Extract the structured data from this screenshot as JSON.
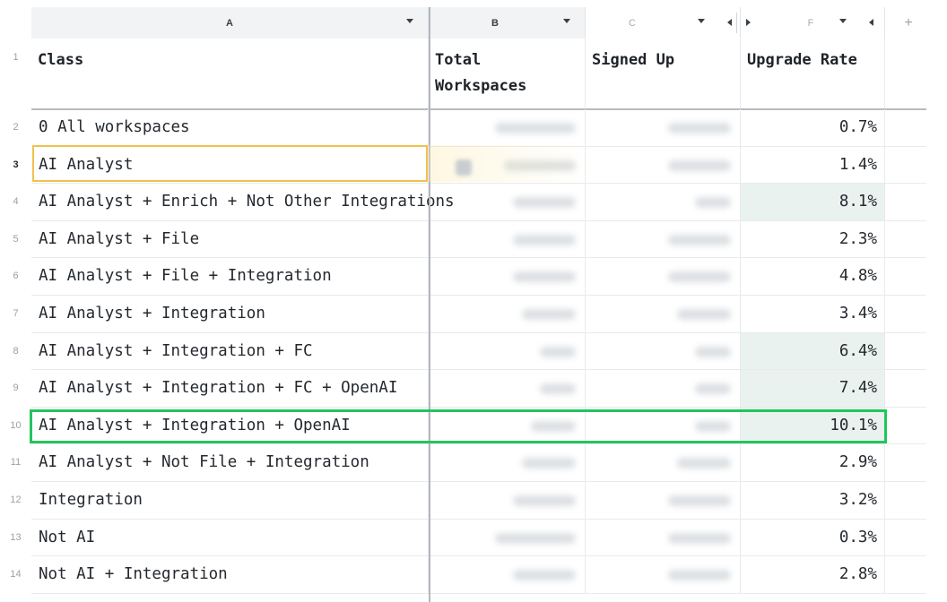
{
  "columns": {
    "a": "A",
    "b": "B",
    "c": "C",
    "f": "F",
    "add": "+"
  },
  "header": {
    "row_number": "1",
    "class": "Class",
    "total_workspaces_line1": "Total",
    "total_workspaces_line2": "Workspaces",
    "signed_up": "Signed Up",
    "upgrade_rate": "Upgrade Rate"
  },
  "rows": [
    {
      "n": "2",
      "class": "0 All workspaces",
      "rate": "0.7%"
    },
    {
      "n": "3",
      "class": "AI Analyst",
      "rate": "1.4%"
    },
    {
      "n": "4",
      "class": "AI Analyst + Enrich + Not Other Integrations",
      "rate": "8.1%"
    },
    {
      "n": "5",
      "class": "AI Analyst + File",
      "rate": "2.3%"
    },
    {
      "n": "6",
      "class": "AI Analyst + File + Integration",
      "rate": "4.8%"
    },
    {
      "n": "7",
      "class": "AI Analyst + Integration",
      "rate": "3.4%"
    },
    {
      "n": "8",
      "class": "AI Analyst + Integration + FC",
      "rate": "6.4%"
    },
    {
      "n": "9",
      "class": "AI Analyst + Integration + FC + OpenAI",
      "rate": "7.4%"
    },
    {
      "n": "10",
      "class": "AI Analyst + Integration + OpenAI",
      "rate": "10.1%"
    },
    {
      "n": "11",
      "class": "AI Analyst + Not File + Integration",
      "rate": "2.9%"
    },
    {
      "n": "12",
      "class": "Integration",
      "rate": "3.2%"
    },
    {
      "n": "13",
      "class": "Not AI",
      "rate": "0.3%"
    },
    {
      "n": "14",
      "class": "Not AI + Integration",
      "rate": "2.8%"
    }
  ],
  "colors": {
    "selection": "#f2c14e",
    "highlight_row": "#22c55e",
    "cell_highlight": "#e9f2ee"
  }
}
